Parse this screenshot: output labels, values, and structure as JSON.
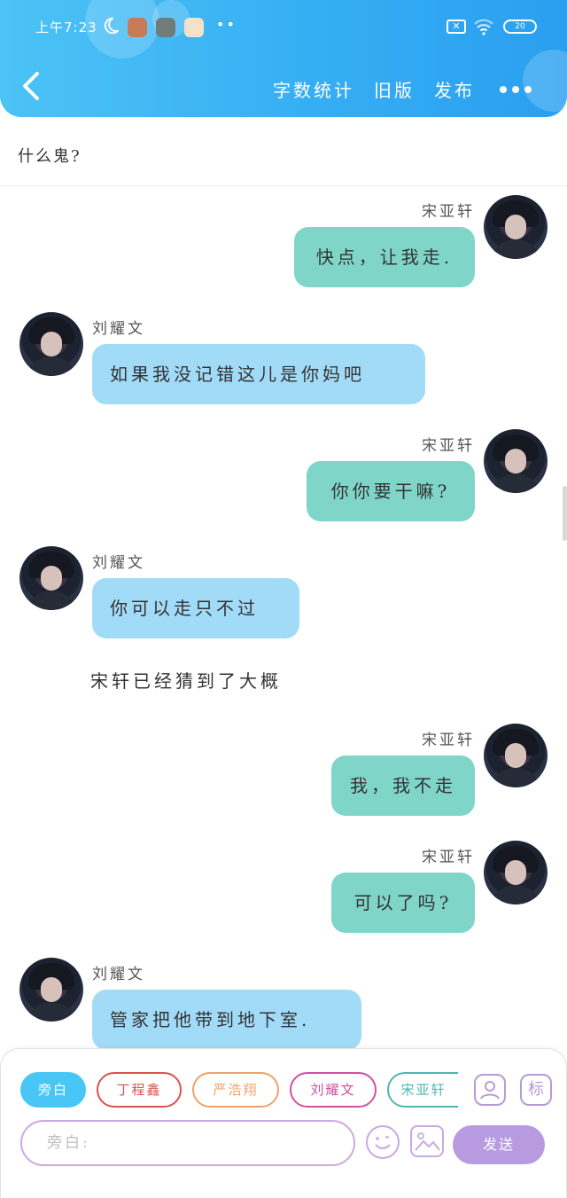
{
  "status_bar": {
    "time": "上午7:23",
    "battery": "20"
  },
  "header": {
    "actions": [
      {
        "label": "字数统计"
      },
      {
        "label": "旧版"
      },
      {
        "label": "发布"
      }
    ]
  },
  "title": "什么鬼?",
  "messages": [
    {
      "side": "right",
      "name": "宋亚轩",
      "text": "快点，让我走."
    },
    {
      "side": "left",
      "name": "刘耀文",
      "text": "如果我没记错这儿是你妈吧"
    },
    {
      "side": "right",
      "name": "宋亚轩",
      "text": "你你要干嘛?"
    },
    {
      "side": "left",
      "name": "刘耀文",
      "text": "你可以走只不过"
    },
    {
      "narration": "宋轩已经猜到了大概"
    },
    {
      "side": "right",
      "name": "宋亚轩",
      "text": "我，我不走"
    },
    {
      "side": "right",
      "name": "宋亚轩",
      "text": "可以了吗?"
    },
    {
      "side": "left",
      "name": "刘耀文",
      "text": "管家把他带到地下室."
    }
  ],
  "composer": {
    "roles": [
      {
        "label": "旁白",
        "active": true,
        "color": "#48c6f5"
      },
      {
        "label": "丁程鑫",
        "active": false,
        "color": "#d9534f"
      },
      {
        "label": "严浩翔",
        "active": false,
        "color": "#f0a16b"
      },
      {
        "label": "刘耀文",
        "active": false,
        "color": "#d24fa2"
      },
      {
        "label": "宋亚轩",
        "active": false,
        "color": "#4fb6b0"
      }
    ],
    "tool_label": "标",
    "input_placeholder": "旁白:",
    "send_label": "发送"
  }
}
